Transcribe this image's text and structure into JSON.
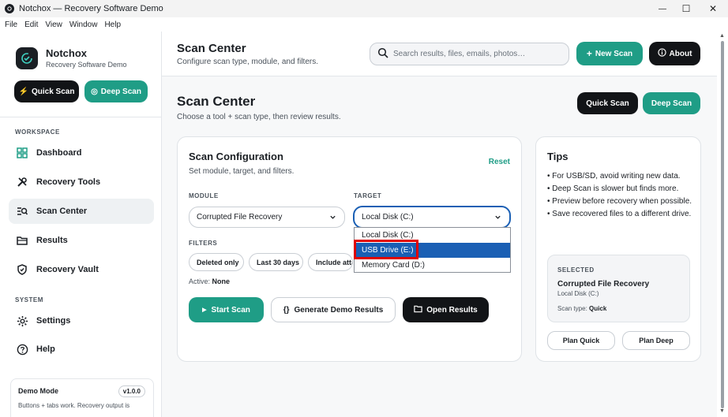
{
  "window": {
    "title": "Notchox — Recovery Software Demo",
    "controls": {
      "minimize": "—",
      "maximize": "☐",
      "close": "✕"
    }
  },
  "menu": [
    "File",
    "Edit",
    "View",
    "Window",
    "Help"
  ],
  "sidebar": {
    "brand_name": "Notchox",
    "brand_sub": "Recovery Software Demo",
    "quick_scan": "Quick Scan",
    "deep_scan": "Deep Scan",
    "workspace_label": "WORKSPACE",
    "items": [
      {
        "label": "Dashboard",
        "icon": "grid-icon"
      },
      {
        "label": "Recovery Tools",
        "icon": "tools-icon"
      },
      {
        "label": "Scan Center",
        "icon": "scan-icon",
        "active": true
      },
      {
        "label": "Results",
        "icon": "folder-icon"
      },
      {
        "label": "Recovery Vault",
        "icon": "shield-icon"
      }
    ],
    "system_label": "SYSTEM",
    "system_items": [
      {
        "label": "Settings",
        "icon": "gear-icon"
      },
      {
        "label": "Help",
        "icon": "help-icon"
      }
    ],
    "demo": {
      "title": "Demo Mode",
      "version": "v1.0.0",
      "desc": "Buttons + tabs work. Recovery output is"
    }
  },
  "header": {
    "title": "Scan Center",
    "subtitle": "Configure scan type, module, and filters.",
    "search_placeholder": "Search results, files, emails, photos…",
    "new_scan": "New Scan",
    "about": "About"
  },
  "main": {
    "title": "Scan Center",
    "subtitle": "Choose a tool + scan type, then review results.",
    "quick_scan": "Quick Scan",
    "deep_scan": "Deep Scan"
  },
  "config": {
    "title": "Scan Configuration",
    "subtitle": "Set module, target, and filters.",
    "reset": "Reset",
    "module_label": "MODULE",
    "module_value": "Corrupted File Recovery",
    "target_label": "TARGET",
    "target_value": "Local Disk (C:)",
    "target_options": [
      "Local Disk (C:)",
      "USB Drive (E:)",
      "Memory Card (D:)"
    ],
    "target_highlighted_index": 1,
    "filters_label": "FILTERS",
    "filters": [
      "Deleted only",
      "Last 30 days",
      "Include atta"
    ],
    "active_prefix": "Active:",
    "active_value": "None",
    "start_scan": "Start Scan",
    "generate_demo": "Generate Demo Results",
    "open_results": "Open Results"
  },
  "tips": {
    "title": "Tips",
    "items": [
      "• For USB/SD, avoid writing new data.",
      "• Deep Scan is slower but finds more.",
      "• Preview before recovery when possible.",
      "• Save recovered files to a different drive."
    ],
    "selected_label": "SELECTED",
    "selected_module": "Corrupted File Recovery",
    "selected_target": "Local Disk (C:)",
    "scan_type_prefix": "Scan type:",
    "scan_type_value": "Quick",
    "plan_quick": "Plan Quick",
    "plan_deep": "Plan Deep"
  },
  "colors": {
    "accent": "#1f9d86",
    "dark": "#121417",
    "selection": "#1a5fb4",
    "highlight": "#e00000"
  }
}
